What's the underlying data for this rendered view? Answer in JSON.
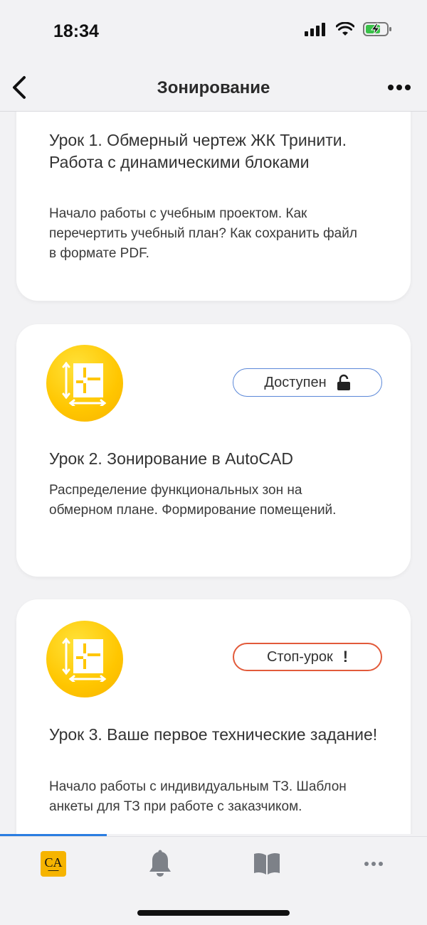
{
  "status_bar": {
    "time": "18:34"
  },
  "nav": {
    "title": "Зонирование"
  },
  "lessons": [
    {
      "title": "Урок 1. Обмерный чертеж ЖК Тринити. Работа с динамическими блоками",
      "description": "Начало работы с учебным проектом. Как перечертить учебный план? Как сохранить файл в формате PDF."
    },
    {
      "title": "Урок 2. Зонирование в AutoCAD",
      "description": "Распределение функциональных зон на обмерном плане. Формирование помещений.",
      "badge": "Доступен",
      "badge_icon": "unlock-icon",
      "badge_color": "#5a87d8"
    },
    {
      "title": "Урок 3. Ваше первое технические задание!",
      "description": "Начало работы с индивидуальным ТЗ. Шаблон анкеты для ТЗ при работе с заказчиком.",
      "badge": "Стоп-урок",
      "badge_icon": "!",
      "badge_color": "#e25a3a"
    }
  ],
  "tab_bar": {
    "logo_letters": "CA",
    "tabs": [
      "home-logo",
      "bell-icon",
      "book-icon",
      "more-icon"
    ]
  },
  "colors": {
    "accent": "#f6b400",
    "progress": "#2a7de1"
  }
}
